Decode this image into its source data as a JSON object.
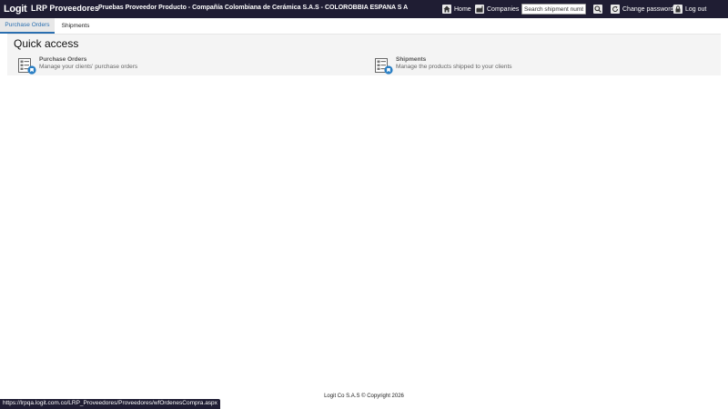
{
  "header": {
    "logo_text": "Logit",
    "app_title": "LRP Proveedores",
    "company_title": "Pruebas Proveedor Producto - Compañía Colombiana de Cerámica S.A.S - COLOROBBIA ESPANA S A",
    "nav": {
      "home": "Home",
      "companies": "Companies",
      "change_password": "Change password",
      "logout": "Log out"
    },
    "search": {
      "placeholder": "Search shipment number"
    },
    "colors": {
      "bar": "#1f1d33",
      "accent": "#2a6fb0"
    }
  },
  "tabs": [
    {
      "label": "Purchase Orders",
      "active": true
    },
    {
      "label": "Shipments",
      "active": false
    }
  ],
  "quick_access": {
    "title": "Quick access",
    "items": [
      {
        "label": "Purchase Orders",
        "description": "Manage your clients' purchase orders",
        "icon": "document-list-icon"
      },
      {
        "label": "Shipments",
        "description": "Manage the products shipped to your clients",
        "icon": "document-list-icon"
      }
    ]
  },
  "footer": {
    "copyright": "Logit Co S.A.S © Copyright 2026"
  },
  "status_bar": {
    "url": "https://lrpqa.logit.com.co/LRP_Proveedores/Proveedores/wfOrdenesCompra.aspx"
  }
}
